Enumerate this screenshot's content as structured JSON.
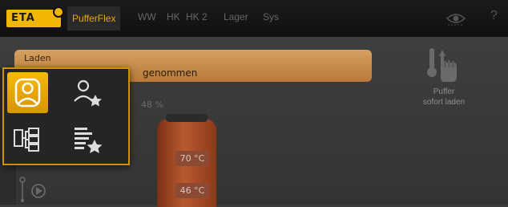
{
  "brand": {
    "logo_text": "ETA",
    "accent": "#f2b705"
  },
  "nav": {
    "tabs": [
      "PufferFlex",
      "WW",
      "HK",
      "HK 2",
      "Lager",
      "Sys"
    ],
    "active_tab": "PufferFlex",
    "help_label": "?"
  },
  "main": {
    "status_title": "Laden",
    "status_text": "genommen",
    "buffer_percent": "48 %",
    "temp_top": "70 °C",
    "temp_bottom": "46 °C"
  },
  "right_action": {
    "line1": "Puffer",
    "line2": "sofort laden"
  },
  "popup_menu": {
    "items": [
      "user-icon",
      "user-favorite-icon",
      "hierarchy-icon",
      "list-favorite-icon"
    ],
    "selected": "user-icon"
  },
  "icons": [
    "eye-icon",
    "help-icon",
    "thermometer-hand-icon",
    "flow-play-icon"
  ]
}
